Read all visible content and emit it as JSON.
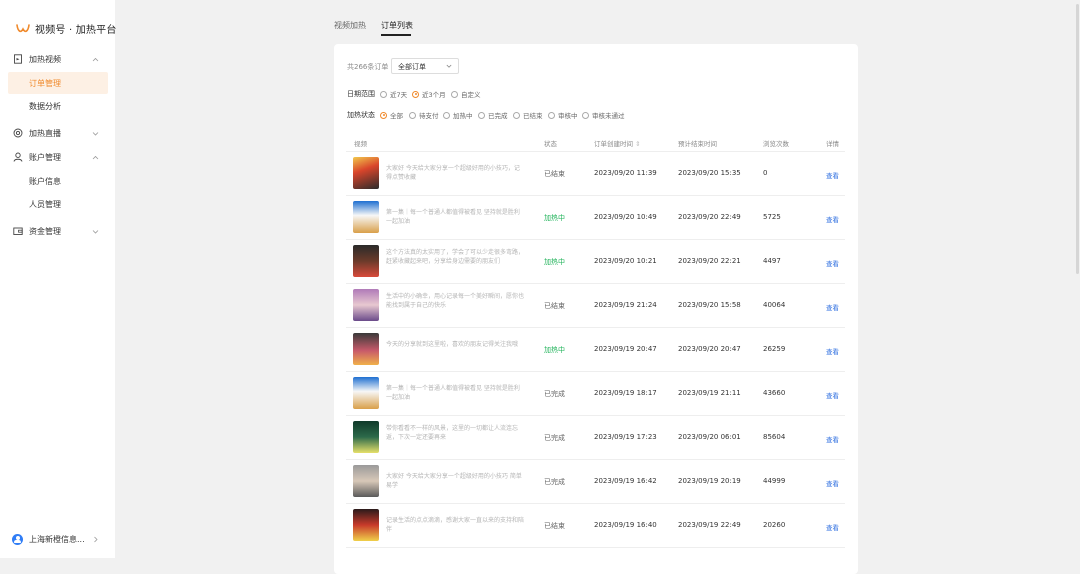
{
  "brand": {
    "title": "视频号 · 加热平台"
  },
  "sidebar": {
    "groups": [
      {
        "label": "加热视频",
        "icon": "document-icon",
        "expanded": true,
        "children": [
          {
            "label": "订单管理",
            "active": true
          },
          {
            "label": "数据分析"
          }
        ]
      },
      {
        "label": "加热直播",
        "icon": "live-icon",
        "expanded": false
      },
      {
        "label": "账户管理",
        "icon": "user-icon",
        "expanded": true,
        "children": [
          {
            "label": "账户信息"
          },
          {
            "label": "人员管理"
          }
        ]
      },
      {
        "label": "资金管理",
        "icon": "wallet-icon",
        "expanded": false
      }
    ],
    "account": {
      "name": "上海新橙信息..."
    }
  },
  "tabs": [
    {
      "label": "视频加热"
    },
    {
      "label": "订单列表",
      "active": true
    }
  ],
  "toolbar": {
    "count": "共266条订单",
    "select_value": "全部订单"
  },
  "filters": {
    "date_label": "日期范围",
    "date_options": [
      "近7天",
      "近3个月",
      "自定义"
    ],
    "date_selected": 1,
    "status_label": "加热状态",
    "status_options": [
      "全部",
      "待支付",
      "加热中",
      "已完成",
      "已结束",
      "审核中",
      "审核未通过"
    ],
    "status_selected": 0
  },
  "table": {
    "headers": [
      "视频",
      "状态",
      "订单创建时间",
      "预计结束时间",
      "浏览次数",
      "详情"
    ],
    "rows": [
      {
        "title": "大家好 今天给大家分享一个超级好用的小技巧，记得点赞收藏",
        "status": "已结束",
        "created": "2023/09/20 11:39",
        "end": "2023/09/20 15:35",
        "views": "0",
        "action": "查看"
      },
      {
        "title": "第一集｜每一个普通人都值得被看见 坚持就是胜利 一起加油",
        "status": "加热中",
        "created": "2023/09/20 10:49",
        "end": "2023/09/20 22:49",
        "views": "5725",
        "action": "查看"
      },
      {
        "title": "这个方法真的太实用了，学会了可以少走很多弯路，赶紧收藏起来吧，分享给身边需要的朋友们",
        "status": "加热中",
        "created": "2023/09/20 10:21",
        "end": "2023/09/20 22:21",
        "views": "4497",
        "action": "查看"
      },
      {
        "title": "生活中的小确幸，用心记录每一个美好瞬间，愿你也能找到属于自己的快乐",
        "status": "已结束",
        "created": "2023/09/19 21:24",
        "end": "2023/09/20 15:58",
        "views": "40064",
        "action": "查看"
      },
      {
        "title": "今天的分享就到这里啦，喜欢的朋友记得关注我哦",
        "status": "加热中",
        "created": "2023/09/19 20:47",
        "end": "2023/09/20 20:47",
        "views": "26259",
        "action": "查看"
      },
      {
        "title": "第一集｜每一个普通人都值得被看见 坚持就是胜利 一起加油",
        "status": "已完成",
        "created": "2023/09/19 18:17",
        "end": "2023/09/19 21:11",
        "views": "43660",
        "action": "查看"
      },
      {
        "title": "带你看看不一样的风景，这里的一切都让人流连忘返，下次一定还要再来",
        "status": "已完成",
        "created": "2023/09/19 17:23",
        "end": "2023/09/20 06:01",
        "views": "85604",
        "action": "查看"
      },
      {
        "title": "大家好 今天给大家分享一个超级好用的小技巧 简单易学",
        "status": "已完成",
        "created": "2023/09/19 16:42",
        "end": "2023/09/19 20:19",
        "views": "44999",
        "action": "查看"
      },
      {
        "title": "记录生活的点点滴滴，感谢大家一直以来的支持和陪伴",
        "status": "已结束",
        "created": "2023/09/19 16:40",
        "end": "2023/09/19 22:49",
        "views": "20260",
        "action": "查看"
      }
    ]
  },
  "colors": {
    "accent": "#f08a2c",
    "active_bg": "#fdf0e4",
    "heating": "#20b35a",
    "link": "#2f6fe0"
  }
}
